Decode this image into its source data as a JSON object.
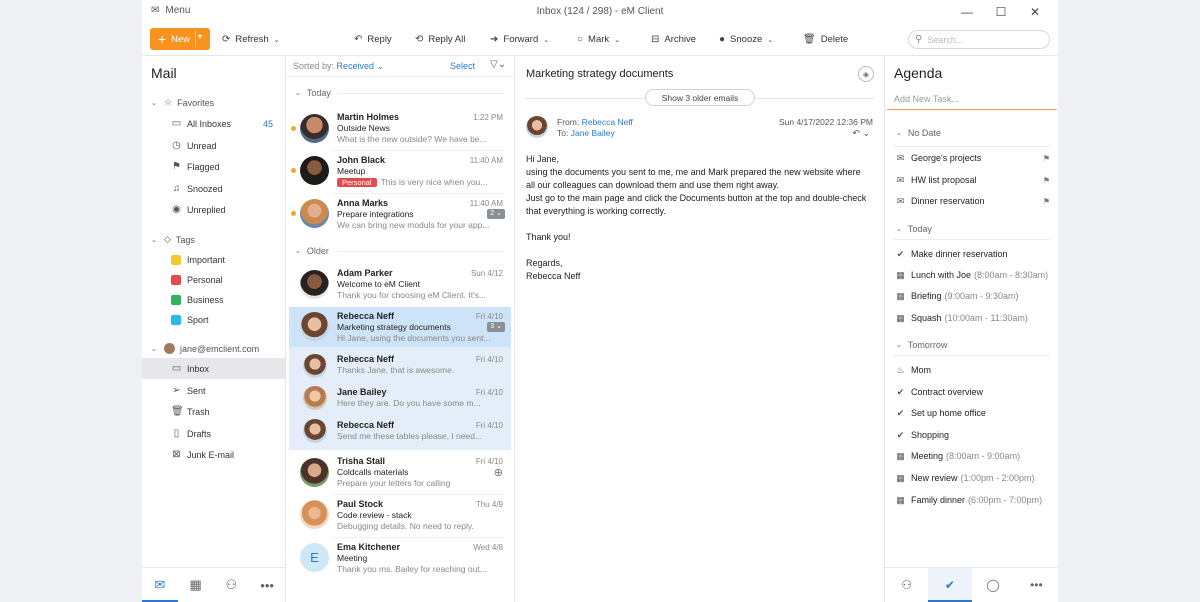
{
  "app": {
    "menu_label": "Menu",
    "window_title": "Inbox (124 / 298) - eM Client"
  },
  "toolbar": {
    "new_label": "New",
    "refresh_label": "Refresh",
    "reply_label": "Reply",
    "reply_all_label": "Reply All",
    "forward_label": "Forward",
    "mark_label": "Mark",
    "archive_label": "Archive",
    "snooze_label": "Snooze",
    "delete_label": "Delete",
    "search_placeholder": "Search..."
  },
  "sidebar": {
    "title": "Mail",
    "favorites_label": "Favorites",
    "favorites": [
      {
        "label": "All Inboxes",
        "count": "45",
        "icon": "inbox-icon"
      },
      {
        "label": "Unread",
        "count": "",
        "icon": "clock-icon"
      },
      {
        "label": "Flagged",
        "count": "",
        "icon": "flag-icon"
      },
      {
        "label": "Snoozed",
        "count": "",
        "icon": "bell-icon"
      },
      {
        "label": "Unreplied",
        "count": "",
        "icon": "eye-icon"
      }
    ],
    "tags_label": "Tags",
    "tags": [
      {
        "label": "Important",
        "color": "#f5c92e"
      },
      {
        "label": "Personal",
        "color": "#e24c4c"
      },
      {
        "label": "Business",
        "color": "#2fb35c"
      },
      {
        "label": "Sport",
        "color": "#2db8e8"
      }
    ],
    "account_label": "jane@emclient.com",
    "folders": [
      {
        "label": "Inbox",
        "icon": "inbox-icon"
      },
      {
        "label": "Sent",
        "icon": "send-icon"
      },
      {
        "label": "Trash",
        "icon": "trash-icon"
      },
      {
        "label": "Drafts",
        "icon": "draft-icon"
      },
      {
        "label": "Junk E-mail",
        "icon": "junk-icon"
      }
    ]
  },
  "list": {
    "sorted_by_label": "Sorted by:",
    "sorted_by_value": "Received",
    "select_label": "Select",
    "group_today": "Today",
    "group_older": "Older",
    "messages": [
      {
        "from": "Martin Holmes",
        "time": "1:22 PM",
        "subject": "Outside News",
        "preview": "What is the new outside? We have be...",
        "unread": true
      },
      {
        "from": "John Black",
        "time": "11:40 AM",
        "subject": "Meetup",
        "tag": "Personal",
        "preview": "This is very nice when you...",
        "unread": true
      },
      {
        "from": "Anna Marks",
        "time": "11:40 AM",
        "subject": "Prepare integrations",
        "preview": "We can bring new moduls for your app...",
        "badge": "2",
        "unread": true
      },
      {
        "from": "Adam Parker",
        "time": "Sun 4/12",
        "subject": "Welcome to eM Client",
        "preview": "Thank you for choosing eM Client. It's..."
      },
      {
        "from": "Rebecca Neff",
        "time": "Fri 4/10",
        "subject": "Marketing strategy documents",
        "preview": "Hi Jane, using the documents you sent...",
        "badge": "3"
      },
      {
        "from": "Rebecca Neff",
        "time": "Fri 4/10",
        "preview": "Thanks Jane, that is awesome."
      },
      {
        "from": "Jane Bailey",
        "time": "Fri 4/10",
        "preview": "Here they are. Do you have some m..."
      },
      {
        "from": "Rebecca Neff",
        "time": "Fri 4/10",
        "preview": "Send me these tables please, I need..."
      },
      {
        "from": "Trisha Stall",
        "time": "Fri 4/10",
        "subject": "Coldcalls materials",
        "preview": "Prepare your letters for calling"
      },
      {
        "from": "Paul Stock",
        "time": "Thu 4/9",
        "subject": "Code review - stack",
        "preview": "Debugging details. No need to reply."
      },
      {
        "from": "Ema Kitchener",
        "time": "Wed 4/8",
        "subject": "Meeting",
        "preview": "Thank you ms. Bailey for reaching out...",
        "initial": "E"
      }
    ]
  },
  "reader": {
    "subject": "Marketing strategy documents",
    "older_label": "Show 3 older emails",
    "from_label": "From:",
    "from_name": "Rebecca Neff",
    "to_label": "To:",
    "to_name": "Jane Bailey",
    "date": "Sun 4/17/2022 12:36 PM",
    "body": [
      "Hi Jane,",
      "using the documents you sent to me, me and Mark prepared the new website where all our colleagues can download them and use them right away.",
      "Just go to the main page and click the Documents button at the top and double-check that everything is working correctly.",
      "",
      "Thank you!",
      "",
      "Regards,",
      "Rebecca Neff"
    ]
  },
  "agenda": {
    "title": "Agenda",
    "add_placeholder": "Add New Task...",
    "no_date_label": "No Date",
    "no_date": [
      {
        "label": "George's projects"
      },
      {
        "label": "HW list proposal"
      },
      {
        "label": "Dinner reservation"
      }
    ],
    "today_label": "Today",
    "today": [
      {
        "label": "Make dinner reservation",
        "time": "",
        "icon": "check"
      },
      {
        "label": "Lunch with Joe",
        "time": "(8:00am - 8:30am)",
        "icon": "cal"
      },
      {
        "label": "Briefing",
        "time": "(9:00am - 9:30am)",
        "icon": "cal"
      },
      {
        "label": "Squash",
        "time": "(10:00am - 11:30am)",
        "icon": "cal"
      }
    ],
    "tomorrow_label": "Tomorrow",
    "tomorrow": [
      {
        "label": "Mom",
        "time": "",
        "icon": "cake"
      },
      {
        "label": "Contract overview",
        "time": "",
        "icon": "check"
      },
      {
        "label": "Set up home office",
        "time": "",
        "icon": "check"
      },
      {
        "label": "Shopping",
        "time": "",
        "icon": "check"
      },
      {
        "label": "Meeting",
        "time": "(8:00am - 9:00am)",
        "icon": "cal"
      },
      {
        "label": "New review",
        "time": "(1:00pm - 2:00pm)",
        "icon": "cal"
      },
      {
        "label": "Family dinner",
        "time": "(6:00pm - 7:00pm)",
        "icon": "cal"
      }
    ]
  }
}
